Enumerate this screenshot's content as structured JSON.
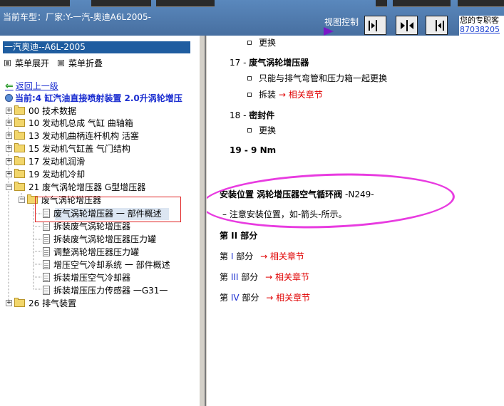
{
  "header": {
    "vehicle_label": "当前车型：厂家:Y-一汽-奥迪A6L2005-",
    "view_control_label": "视图控制",
    "top_right_line1": "您的专职客",
    "top_right_line2": "87038205"
  },
  "left": {
    "tree_title": "一汽奥迪--A6L-2005",
    "expand_label": "菜单展开",
    "collapse_label": "菜单折叠",
    "back_label": "返回上一级",
    "current_label": "当前:4 缸汽油直接喷射装置  2.0升涡轮增压",
    "tree": [
      {
        "expander": "+",
        "label": "00 技术数据"
      },
      {
        "expander": "+",
        "label": "10 发动机总成 气缸 曲轴箱"
      },
      {
        "expander": "+",
        "label": "13 发动机曲柄连杆机构 活塞"
      },
      {
        "expander": "+",
        "label": "15 发动机气缸盖 气门结构"
      },
      {
        "expander": "+",
        "label": "17 发动机润滑"
      },
      {
        "expander": "+",
        "label": "19 发动机冷却"
      },
      {
        "expander": "−",
        "label": "21 废气涡轮增压器 G型增压器"
      },
      {
        "expander": "−",
        "label": "废气涡轮增压器"
      },
      {
        "label": "废气涡轮增压器 一 部件概述"
      },
      {
        "label": "拆装废气涡轮增压器"
      },
      {
        "label": "拆装废气涡轮增压器压力罐"
      },
      {
        "label": "调整涡轮增压器压力罐"
      },
      {
        "label": "增压空气冷却系统 一 部件概述"
      },
      {
        "label": "拆装增压空气冷却器"
      },
      {
        "label": "拆装增压压力传感器 一G31一"
      },
      {
        "expander": "+",
        "label": "26 排气装置"
      }
    ]
  },
  "content": {
    "replace_top": "更换",
    "item17_num": "17 -",
    "item17_title": "废气涡轮增压器",
    "item17_b1": "只能与排气弯管和压力箱一起更换",
    "item17_b2": "拆装",
    "item17_b2_link": "→ 相关章节",
    "item18_num": "18 -",
    "item18_title": "密封件",
    "item18_b1": "更换",
    "item19": "19 - 9 Nm",
    "install_title": "安装位置  涡轮增压器空气循环阀",
    "install_code": "-N249-",
    "install_note": "–  注意安装位置，如-箭头-所示。",
    "part2_heading": "第 II 部分",
    "part1_prefix": "第",
    "part1_roman": "I",
    "part1_suffix": "部分",
    "part1_link": "→ 相关章节",
    "part3_prefix": "第",
    "part3_roman": "III",
    "part3_suffix": "部分",
    "part3_link": "→ 相关章节",
    "part4_prefix": "第",
    "part4_roman": "IV",
    "part4_suffix": "部分",
    "part4_link": "→ 相关章节"
  },
  "colors": {
    "header_bg": "#4f7eb3",
    "tree_title_bg": "#1f5da0",
    "link_red": "#e00000",
    "annotation_oval": "#e83be0",
    "annotation_box": "#e02424"
  }
}
